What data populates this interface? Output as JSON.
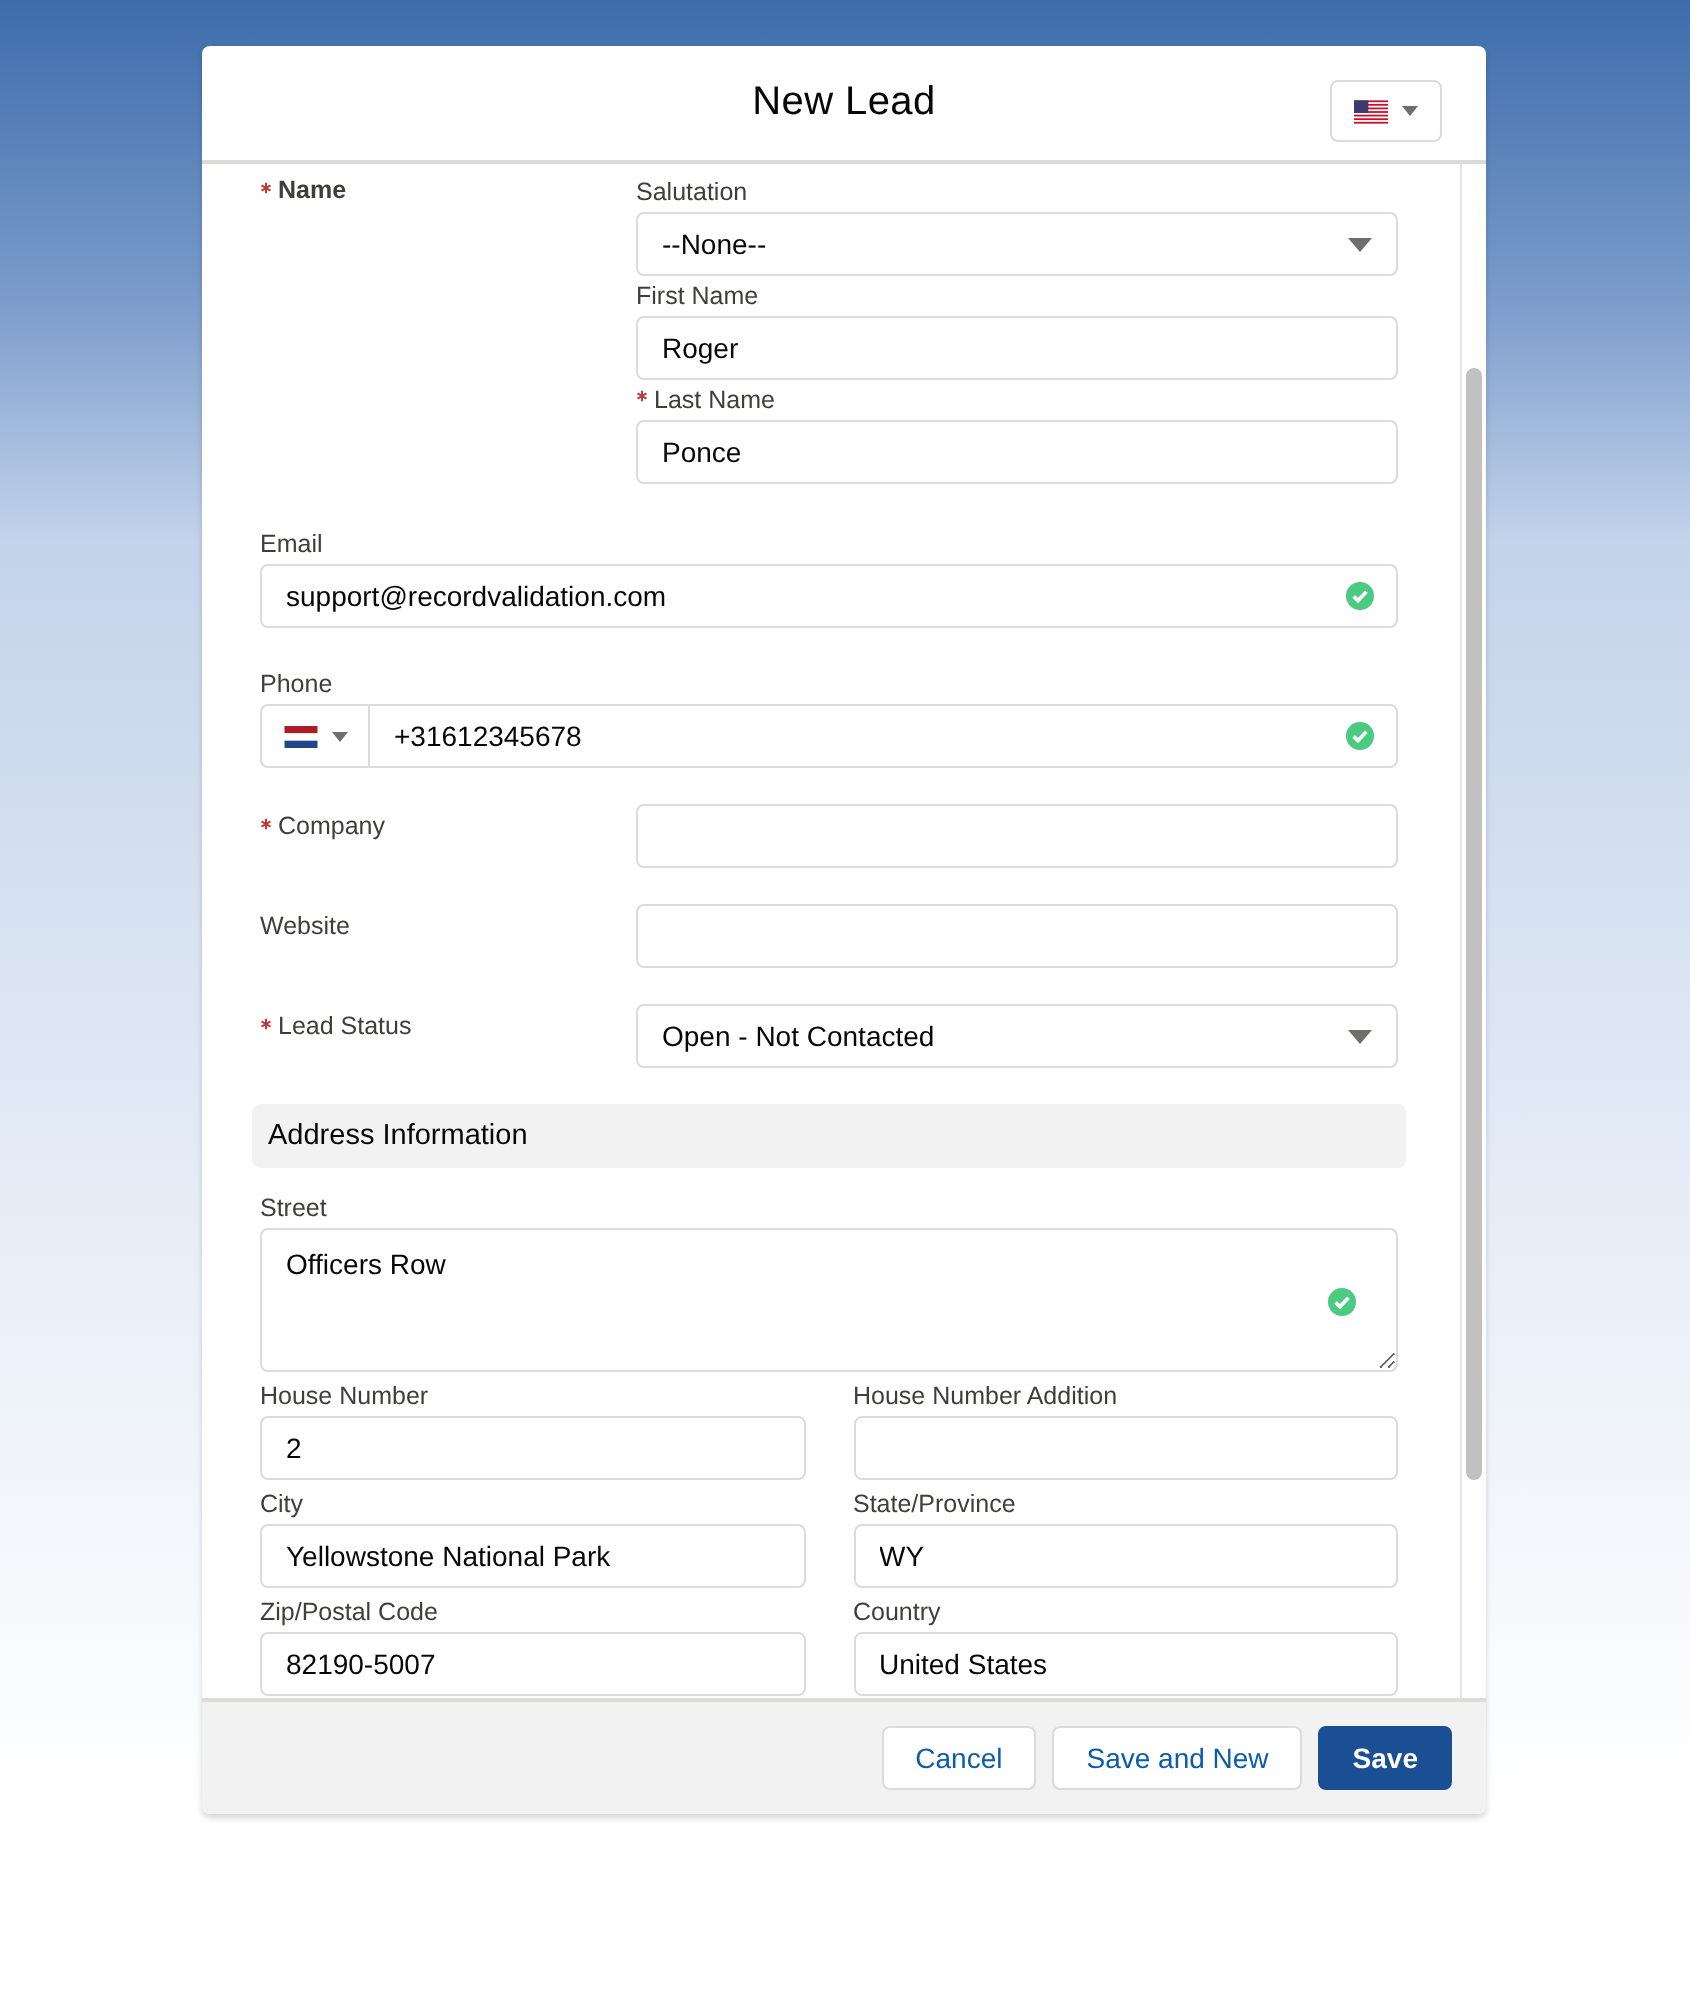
{
  "modal": {
    "title": "New Lead"
  },
  "name_group": {
    "label": "Name",
    "required": true,
    "fields": [
      {
        "label": "Salutation",
        "kind": "select",
        "value": "--None--",
        "required": false
      },
      {
        "label": "First Name",
        "kind": "text",
        "value": "Roger",
        "required": false
      },
      {
        "label": "Last Name",
        "kind": "text",
        "value": "Ponce",
        "required": true
      }
    ]
  },
  "stacked_fields": [
    {
      "label": "Email",
      "kind": "text",
      "value": "support@recordvalidation.com",
      "required": false,
      "valid": true
    },
    {
      "label": "Phone",
      "kind": "phone",
      "value": "+31612345678",
      "required": false,
      "valid": true
    }
  ],
  "inline_fields": [
    {
      "label": "Company",
      "kind": "text",
      "required": true,
      "valid": false
    },
    {
      "label": "Website",
      "kind": "text",
      "required": false,
      "valid": false
    },
    {
      "label": "Lead Status",
      "kind": "select",
      "value": "Open - Not Contacted",
      "required": true,
      "valid": false
    }
  ],
  "address": {
    "title": "Address Information",
    "street": {
      "label": "Street",
      "value": "Officers Row",
      "valid": true
    },
    "fields": [
      {
        "label": "House Number",
        "value": "2"
      },
      {
        "label": "House Number Addition"
      },
      {
        "label": "City",
        "value": "Yellowstone National Park"
      },
      {
        "label": "State/Province",
        "value": "WY"
      },
      {
        "label": "Zip/Postal Code",
        "value": "82190-5007"
      },
      {
        "label": "Country",
        "value": "United States"
      }
    ]
  },
  "footer": {
    "buttons": [
      {
        "label": "Cancel",
        "kind": "neutral"
      },
      {
        "label": "Save and New",
        "kind": "neutral"
      },
      {
        "label": "Save",
        "kind": "brand"
      }
    ]
  }
}
